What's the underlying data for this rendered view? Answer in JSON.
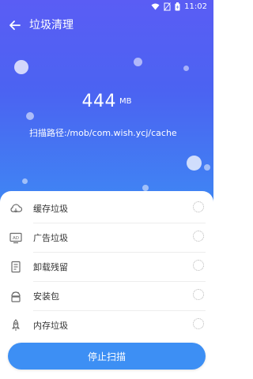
{
  "status_bar": {
    "time": "11:02"
  },
  "header": {
    "title": "垃圾清理"
  },
  "scan": {
    "size_value": "444",
    "size_unit": "MB",
    "path": "扫描路径:/mob/com.wish.ycj/cache"
  },
  "items": [
    {
      "label": "缓存垃圾",
      "icon": "cloud-icon"
    },
    {
      "label": "广告垃圾",
      "icon": "ad-icon"
    },
    {
      "label": "卸载残留",
      "icon": "uninstall-residue-icon"
    },
    {
      "label": "安装包",
      "icon": "android-package-icon"
    },
    {
      "label": "内存垃圾",
      "icon": "rocket-icon"
    }
  ],
  "actions": {
    "stop_label": "停止扫描"
  },
  "colors": {
    "gradient_top": "#5a5df4",
    "gradient_bottom": "#3f86f3",
    "button": "#3d8ff4"
  }
}
